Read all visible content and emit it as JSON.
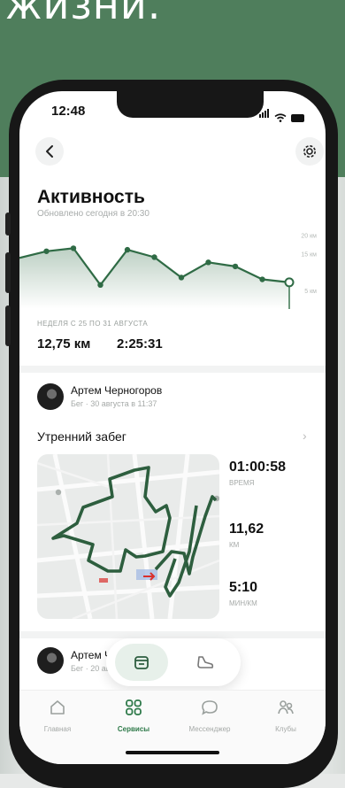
{
  "banner": {
    "text": "жизни."
  },
  "status_bar": {
    "time": "12:48"
  },
  "header": {
    "back_icon": "chevron-left-icon",
    "settings_icon": "gear-icon"
  },
  "activity": {
    "title": "Активность",
    "updated": "Обновлено сегодня в 20:30",
    "week_label": "НЕДЕЛЯ С 25 ПО 31 АВГУСТА",
    "distance": "12,75 км",
    "duration": "2:25:31"
  },
  "chart_data": {
    "type": "area",
    "y_labels": [
      "20 км",
      "15 км",
      "5 км"
    ],
    "values": [
      13.8,
      15.6,
      16.4,
      6.5,
      16.0,
      14.0,
      8.5,
      12.6,
      11.5,
      8.0,
      7.2
    ],
    "ylim": [
      0,
      22
    ],
    "selected_index": 10,
    "accent": "#2f6b45"
  },
  "post1": {
    "user": "Артем Черногоров",
    "meta": "Бег · 30 августа в 11:37",
    "workout": "Утренний забег",
    "stats": [
      {
        "value": "01:00:58",
        "label": "ВРЕМЯ"
      },
      {
        "value": "11,62",
        "label": "КМ"
      },
      {
        "value": "5:10",
        "label": "МИН/КМ"
      }
    ]
  },
  "post2": {
    "user": "Артем Ч",
    "meta": "Бег · 20 ав"
  },
  "fab": {
    "left_icon": "calendar-icon",
    "right_icon": "shoe-icon"
  },
  "tabs": [
    {
      "label": "Главная",
      "icon": "home-icon",
      "active": false
    },
    {
      "label": "Сервисы",
      "icon": "grid-icon",
      "active": true
    },
    {
      "label": "Мессенджер",
      "icon": "chat-icon",
      "active": false
    },
    {
      "label": "Клубы",
      "icon": "club-icon",
      "active": false
    }
  ]
}
